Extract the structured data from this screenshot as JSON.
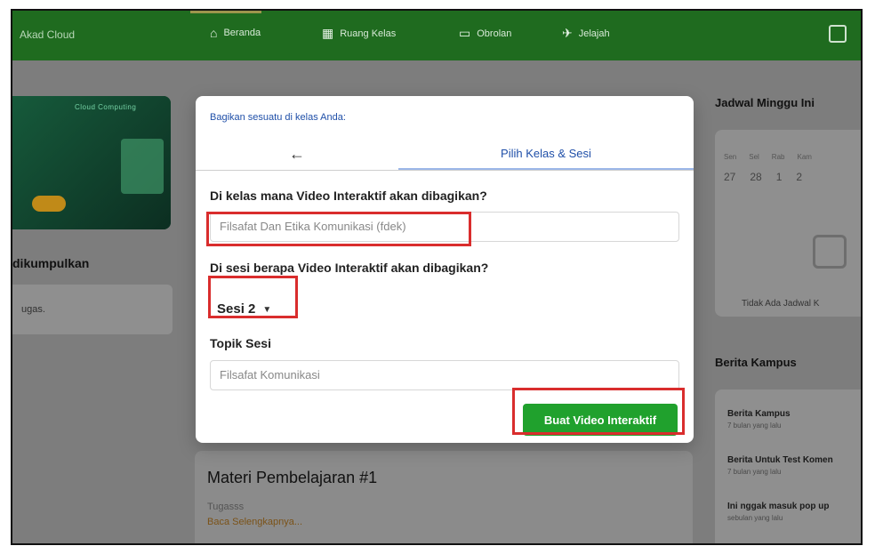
{
  "app": {
    "brand": "Akad Cloud",
    "nav": [
      {
        "label": "Beranda",
        "icon": "home-icon"
      },
      {
        "label": "Ruang Kelas",
        "icon": "building-icon"
      },
      {
        "label": "Obrolan",
        "icon": "chat-icon"
      },
      {
        "label": "Jelajah",
        "icon": "explore-icon"
      }
    ],
    "right_icon": "copy-icon"
  },
  "left": {
    "promo_tag": "Cloud Computing",
    "heading": "dikumpulkan",
    "box_text": "ugas."
  },
  "modal": {
    "header": "Bagikan sesuatu di kelas Anda:",
    "back_label": "←",
    "tab_label": "Pilih Kelas & Sesi",
    "q1": "Di kelas mana Video Interaktif akan dibagikan?",
    "class_value": "Filsafat Dan Etika Komunikasi (fdek)",
    "q2": "Di sesi berapa Video Interaktif akan dibagikan?",
    "session_value": "Sesi 2",
    "topic_label": "Topik Sesi",
    "topic_value": "Filsafat Komunikasi",
    "submit_label": "Buat Video Interaktif"
  },
  "right": {
    "schedule_heading": "Jadwal Minggu Ini",
    "days": [
      "Sen",
      "Sel",
      "Rab",
      "Kam"
    ],
    "dates": [
      "27",
      "28",
      "1",
      "2"
    ],
    "empty": "Tidak Ada Jadwal K",
    "news_heading": "Berita Kampus",
    "news": [
      {
        "title": "Berita Kampus",
        "time": "7 bulan yang lalu"
      },
      {
        "title": "Berita Untuk Test Komen",
        "time": "7 bulan yang lalu"
      },
      {
        "title": "Ini nggak masuk pop up",
        "time": "sebulan yang lalu"
      }
    ]
  },
  "background": {
    "center_title": "Materi Pembelajaran #1",
    "center_sub": "Tugasss",
    "center_link": "Baca Selengkapnya..."
  }
}
